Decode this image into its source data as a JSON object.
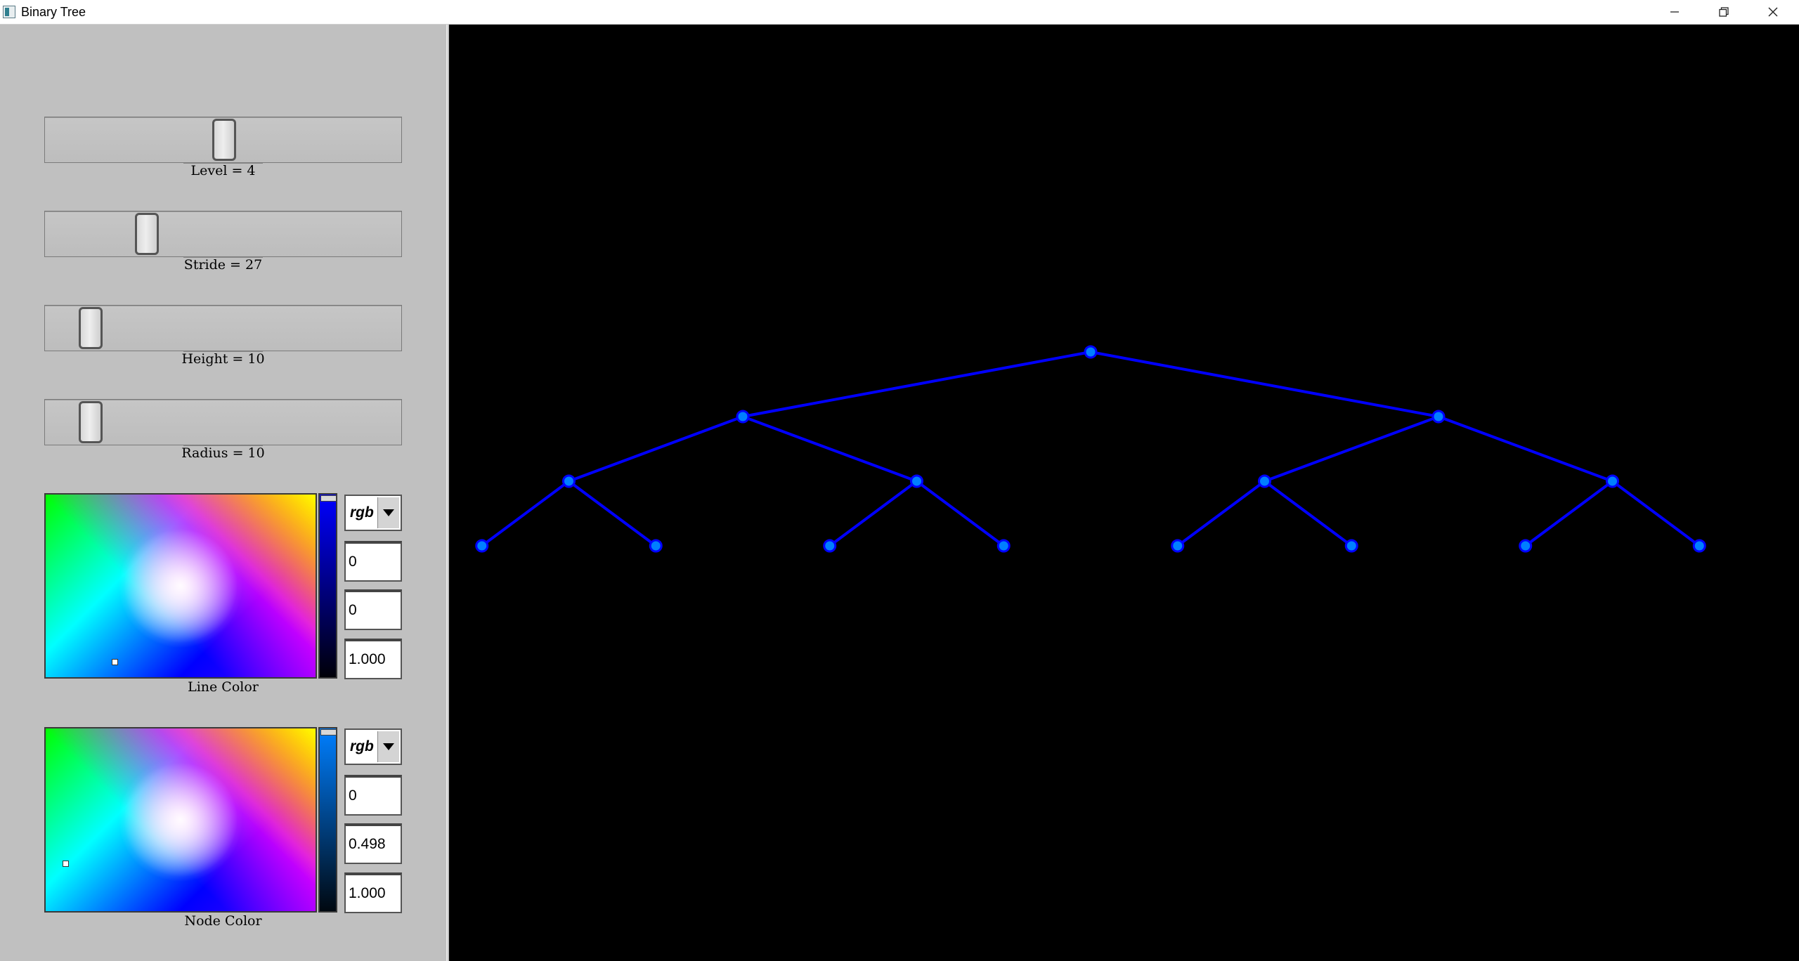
{
  "window": {
    "title": "Binary Tree",
    "minimize_icon": "minimize-icon",
    "restore_icon": "restore-icon",
    "close_icon": "close-icon"
  },
  "controls": {
    "level": {
      "label": "Level = 4",
      "value": 4
    },
    "stride": {
      "label": "Stride = 27",
      "value": 27
    },
    "height": {
      "label": "Height = 10",
      "value": 10
    },
    "radius": {
      "label": "Radius = 10",
      "value": 10
    }
  },
  "line_color": {
    "label": "Line Color",
    "mode": "rgb",
    "r": "0",
    "g": "0",
    "b": "1.000",
    "color": "#0000ff"
  },
  "node_color": {
    "label": "Node Color",
    "mode": "rgb",
    "r": "0",
    "g": "0.498",
    "b": "1.000",
    "color": "#007fff"
  },
  "tree": {
    "levels": 4,
    "background": "#000000"
  }
}
